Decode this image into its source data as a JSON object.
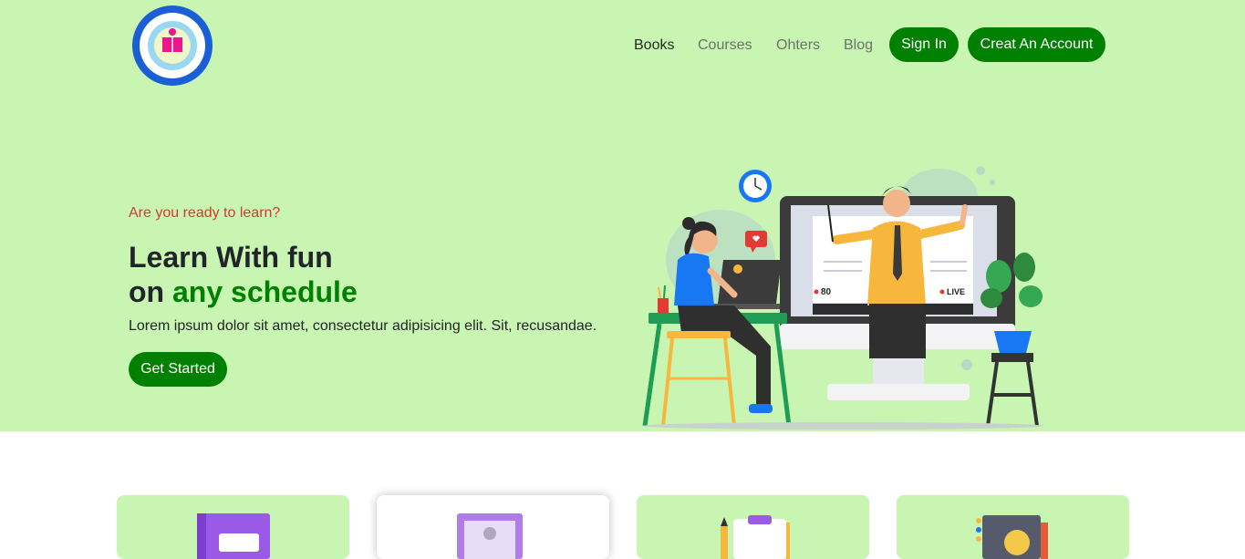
{
  "header": {
    "logo_icon": "school-seal-logo",
    "nav": [
      {
        "label": "Books",
        "active": true
      },
      {
        "label": "Courses",
        "active": false
      },
      {
        "label": "Ohters",
        "active": false
      },
      {
        "label": "Blog",
        "active": false
      }
    ],
    "sign_in_label": "Sign In",
    "create_account_label": "Creat An Account"
  },
  "hero": {
    "kicker": "Are you ready to learn?",
    "headline_line1": "Learn With fun",
    "headline_line2_prefix": "on ",
    "headline_line2_accent": "any schedule",
    "lead": "Lorem ipsum dolor sit amet, consectetur adipisicing elit. Sit, recusandae.",
    "cta_label": "Get Started",
    "illustration": {
      "viewer_count": "80",
      "live_label": "LIVE"
    }
  },
  "cards": [
    {
      "icon": "book-icon",
      "highlighted": false
    },
    {
      "icon": "profile-card-icon",
      "highlighted": true
    },
    {
      "icon": "clipboard-pencil-icon",
      "highlighted": false
    },
    {
      "icon": "notebook-icon",
      "highlighted": false
    }
  ],
  "colors": {
    "hero_bg": "#c9f5b3",
    "accent_green": "#008000",
    "kicker_red": "#d63a2f"
  }
}
